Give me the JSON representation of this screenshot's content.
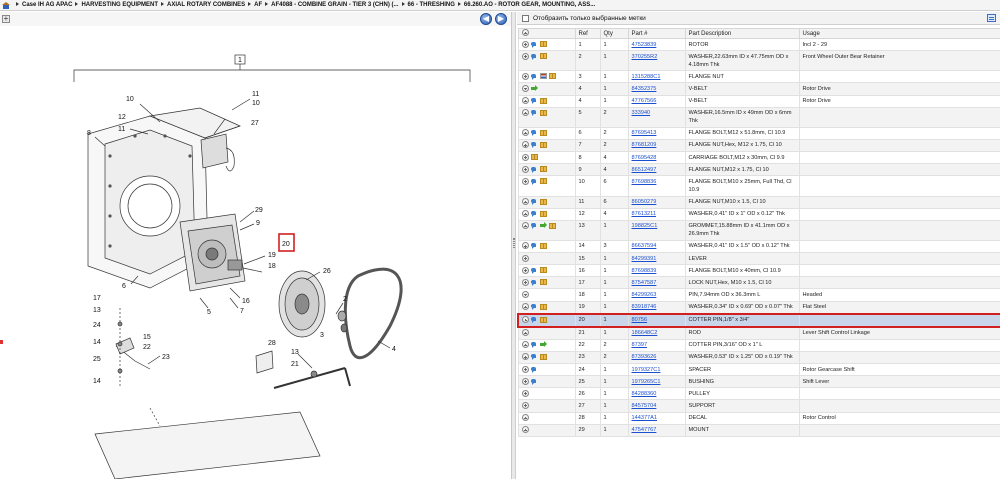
{
  "breadcrumb": [
    "Case IH AG APAC",
    "HARVESTING EQUIPMENT",
    "AXIAL ROTARY COMBINES",
    "AF",
    "AF4088 - COMBINE GRAIN - TIER 3 (CHN) (...",
    "66 - THRESHING",
    "66.260.AO - ROTOR GEAR, MOUNTING, ASS..."
  ],
  "nav": {
    "back": "◀",
    "forward": "▶",
    "zoom": "+"
  },
  "filter": {
    "label": "Отобразить только выбранные метки"
  },
  "table": {
    "columns": [
      "",
      "Ref",
      "Qty",
      "Part #",
      "Part Description",
      "Usage"
    ],
    "rows": [
      {
        "icons": [
          "info",
          "box"
        ],
        "ref": "1",
        "qty": "1",
        "part": "47523839",
        "desc": "ROTOR",
        "usage": "Incl 2 - 29"
      },
      {
        "icons": [
          "info",
          "box"
        ],
        "ref": "2",
        "qty": "1",
        "part": "370255R2",
        "desc": "WASHER,22.63mm ID x 47.75mm OD x 4.18mm Thk",
        "usage": "Front Wheel Outer Bear Retainer"
      },
      {
        "icons": [
          "info",
          "flag",
          "box"
        ],
        "ref": "3",
        "qty": "1",
        "part": "1315288C1",
        "desc": "FLANGE NUT",
        "usage": ""
      },
      {
        "icons": [
          "arrow"
        ],
        "ref": "4",
        "qty": "1",
        "part": "84352375",
        "desc": "V-BELT",
        "usage": "Rotor Drive"
      },
      {
        "icons": [
          "info",
          "box"
        ],
        "ref": "4",
        "qty": "1",
        "part": "47767566",
        "desc": "V-BELT",
        "usage": "Rotor Drive"
      },
      {
        "icons": [
          "info",
          "box"
        ],
        "ref": "5",
        "qty": "2",
        "part": "333940",
        "desc": "WASHER,16.5mm ID x 49mm OD x 6mm Thk",
        "usage": ""
      },
      {
        "icons": [
          "info",
          "box"
        ],
        "ref": "6",
        "qty": "2",
        "part": "87695413",
        "desc": "FLANGE BOLT,M12 x 51.8mm, Cl 10.9",
        "usage": ""
      },
      {
        "icons": [
          "info",
          "box"
        ],
        "ref": "7",
        "qty": "2",
        "part": "87681209",
        "desc": "FLANGE NUT,Hex, M12 x 1.75, Cl 10",
        "usage": ""
      },
      {
        "icons": [
          "box"
        ],
        "ref": "8",
        "qty": "4",
        "part": "87695428",
        "desc": "CARRIAGE BOLT,M12 x 30mm, Cl 9.9",
        "usage": ""
      },
      {
        "icons": [
          "info",
          "box"
        ],
        "ref": "9",
        "qty": "4",
        "part": "86512497",
        "desc": "FLANGE NUT,M12 x 1.75, Cl 10",
        "usage": ""
      },
      {
        "icons": [
          "info",
          "box"
        ],
        "ref": "10",
        "qty": "6",
        "part": "87698836",
        "desc": "FLANGE BOLT,M10 x 25mm, Full Thd, Cl 10.9",
        "usage": ""
      },
      {
        "icons": [
          "info",
          "box"
        ],
        "ref": "11",
        "qty": "6",
        "part": "86050279",
        "desc": "FLANGE NUT,M10 x 1.5, Cl 10",
        "usage": ""
      },
      {
        "icons": [
          "info",
          "box"
        ],
        "ref": "12",
        "qty": "4",
        "part": "87613211",
        "desc": "WASHER,0.41\" ID x 1\" OD x 0.12\" Thk",
        "usage": ""
      },
      {
        "icons": [
          "info",
          "arrow",
          "box"
        ],
        "ref": "13",
        "qty": "1",
        "part": "198825C1",
        "desc": "GROMMET,15.88mm ID x 41.1mm OD x 26.9mm Thk",
        "usage": ""
      },
      {
        "icons": [
          "info",
          "box"
        ],
        "ref": "14",
        "qty": "3",
        "part": "86637594",
        "desc": "WASHER,0.41\" ID x 1.5\" OD x 0.12\" Thk",
        "usage": ""
      },
      {
        "icons": [],
        "ref": "15",
        "qty": "1",
        "part": "84299391",
        "desc": "LEVER",
        "usage": ""
      },
      {
        "icons": [
          "info",
          "box"
        ],
        "ref": "16",
        "qty": "1",
        "part": "87698839",
        "desc": "FLANGE BOLT,M10 x 40mm, Cl 10.9",
        "usage": ""
      },
      {
        "icons": [
          "info",
          "box"
        ],
        "ref": "17",
        "qty": "1",
        "part": "87547587",
        "desc": "LOCK NUT,Hex, M10 x 1.5, Cl 10",
        "usage": ""
      },
      {
        "icons": [],
        "ref": "18",
        "qty": "1",
        "part": "84299263",
        "desc": "PIN,7.94mm OD x 36.3mm L",
        "usage": "Headed"
      },
      {
        "icons": [
          "info",
          "box"
        ],
        "ref": "19",
        "qty": "1",
        "part": "83918746",
        "desc": "WASHER,0.34\" ID x 0.69\" OD x 0.07\" Thk",
        "usage": "Flat Steel"
      },
      {
        "icons": [
          "info",
          "box"
        ],
        "ref": "20",
        "qty": "1",
        "part": "80756",
        "desc": "COTTER PIN,1/8\" x 3/4\"",
        "usage": "",
        "selected": true
      },
      {
        "icons": [],
        "ref": "21",
        "qty": "1",
        "part": "186648C2",
        "desc": "ROD",
        "usage": "Lever Shift Control Linkage"
      },
      {
        "icons": [
          "info",
          "arrow"
        ],
        "ref": "22",
        "qty": "2",
        "part": "87397",
        "desc": "COTTER PIN,3/16\" OD x 1\" L",
        "usage": ""
      },
      {
        "icons": [
          "info",
          "box"
        ],
        "ref": "23",
        "qty": "2",
        "part": "87393626",
        "desc": "WASHER,0.53\" ID x 1.25\" OD x 0.19\" Thk",
        "usage": ""
      },
      {
        "icons": [
          "info"
        ],
        "ref": "24",
        "qty": "1",
        "part": "1979327C1",
        "desc": "SPACER",
        "usage": "Rotor Gearcase Shift"
      },
      {
        "icons": [
          "info"
        ],
        "ref": "25",
        "qty": "1",
        "part": "1979265C1",
        "desc": "BUSHING",
        "usage": "Shift Lever"
      },
      {
        "icons": [],
        "ref": "26",
        "qty": "1",
        "part": "84288360",
        "desc": "PULLEY",
        "usage": ""
      },
      {
        "icons": [],
        "ref": "27",
        "qty": "1",
        "part": "84575704",
        "desc": "SUPPORT",
        "usage": ""
      },
      {
        "icons": [],
        "ref": "28",
        "qty": "1",
        "part": "144377A1",
        "desc": "DECAL",
        "usage": "Rotor Control"
      },
      {
        "icons": [],
        "ref": "29",
        "qty": "1",
        "part": "47547767",
        "desc": "MOUNT",
        "usage": ""
      }
    ]
  },
  "diagram": {
    "callouts": [
      "1",
      "2",
      "3",
      "4",
      "5",
      "6",
      "7",
      "8",
      "9",
      "10",
      "11",
      "12",
      "13",
      "14",
      "15",
      "16",
      "17",
      "18",
      "19",
      "20",
      "21",
      "22",
      "23",
      "24",
      "25",
      "26",
      "27",
      "28",
      "29"
    ],
    "labels": {
      "c1": "1",
      "c10a": "10",
      "c11a": "11",
      "c10b": "10",
      "c27": "27",
      "c12": "12",
      "c11b": "11",
      "c8": "8",
      "c29": "29",
      "c9": "9",
      "c20": "20",
      "c19": "19",
      "c18": "18",
      "c26": "26",
      "c2": "2",
      "c6": "6",
      "c16": "16",
      "c5": "5",
      "c7": "7",
      "c17": "17",
      "c13a": "13",
      "c24": "24",
      "c15": "15",
      "c22": "22",
      "c23": "23",
      "c3": "3",
      "c4": "4",
      "c25": "25",
      "c14a": "14",
      "c14b": "14",
      "c28": "28",
      "c13b": "13",
      "c21": "21"
    }
  },
  "colors": {
    "link": "#1a4fd0",
    "highlight": "#d21f1f",
    "selected_bg": "#c9d6ea",
    "accent": "#2f62b8"
  }
}
